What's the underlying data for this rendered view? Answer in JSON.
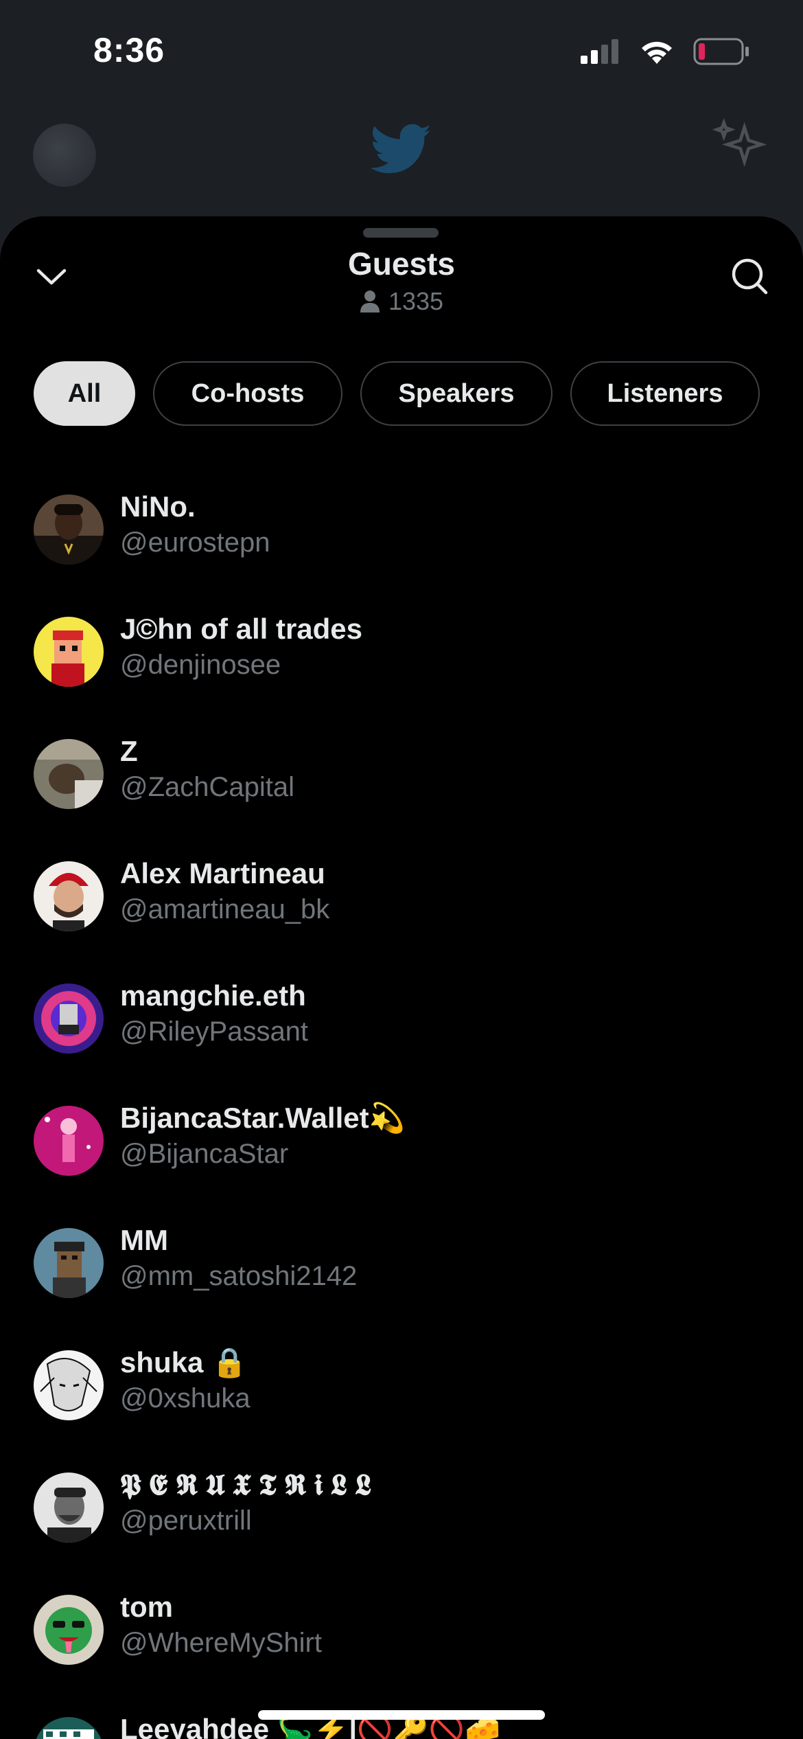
{
  "status_bar": {
    "time": "8:36",
    "icons": [
      "cellular-signal-icon",
      "wifi-icon",
      "battery-low-icon"
    ]
  },
  "background_app": {
    "icons": [
      "profile-avatar",
      "twitter-bird-icon",
      "sparkle-icon"
    ]
  },
  "sheet": {
    "title": "Guests",
    "guest_count": "1335",
    "collapse_icon": "chevron-down-icon",
    "search_icon": "search-icon"
  },
  "filters": [
    {
      "label": "All",
      "active": true
    },
    {
      "label": "Co-hosts",
      "active": false
    },
    {
      "label": "Speakers",
      "active": false
    },
    {
      "label": "Listeners",
      "active": false
    }
  ],
  "guests": [
    {
      "name": "NiNo.",
      "handle": "@eurostepn"
    },
    {
      "name": "J©hn of all trades",
      "handle": "@denjinosee"
    },
    {
      "name": "Z",
      "handle": "@ZachCapital"
    },
    {
      "name": "Alex Martineau",
      "handle": "@amartineau_bk"
    },
    {
      "name": "mangchie.eth",
      "handle": "@RileyPassant"
    },
    {
      "name": "BijancaStar.Wallet💫",
      "handle": "@BijancaStar"
    },
    {
      "name": "MM",
      "handle": "@mm_satoshi2142"
    },
    {
      "name": "shuka 🔒",
      "handle": "@0xshuka"
    },
    {
      "name": "𝕻 𝕰 𝕽 𝖀 𝖃 𝕿 𝕽 𝖎 𝕷 𝕷",
      "handle": "@peruxtrill"
    },
    {
      "name": "tom",
      "handle": "@WhereMyShirt"
    },
    {
      "name": "Leeyahdee 🦕⚡️|🚫🔑🚫🧀",
      "handle": ""
    }
  ],
  "colors": {
    "sheet_background": "#000000",
    "dimmed_background": "#1c1f23",
    "primary_text": "#e7e9ea",
    "secondary_text": "#71767b",
    "active_chip": "#e1e1e1",
    "chip_border": "#3d4247",
    "battery_low": "#e0245e"
  }
}
